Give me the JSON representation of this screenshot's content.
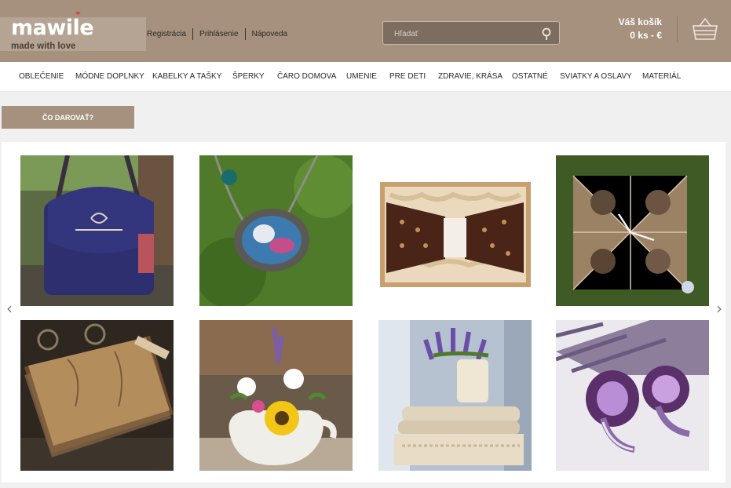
{
  "brand": {
    "name": "mawile",
    "tagline": "made with love"
  },
  "top_links": [
    {
      "label": "Registrácia"
    },
    {
      "label": "Prihlásenie"
    },
    {
      "label": "Nápoveda"
    }
  ],
  "search": {
    "placeholder": "Hľadať",
    "icon": "search-icon"
  },
  "cart": {
    "title": "Váš košík",
    "count": "0 ks - €",
    "icon": "basket-icon"
  },
  "nav": [
    {
      "label": "OBLEČENIE"
    },
    {
      "label": "MÓDNE DOPLNKY"
    },
    {
      "label": "KABELKY A TAŠKY"
    },
    {
      "label": "ŠPERKY"
    },
    {
      "label": "ČARO DOMOVA"
    },
    {
      "label": "UMENIE"
    },
    {
      "label": "PRE DETI"
    },
    {
      "label": "ZDRAVIE, KRÁSA"
    },
    {
      "label": "OSTATNÉ"
    },
    {
      "label": "SVIATKY A OSLAVY"
    },
    {
      "label": "MATERIÁL"
    }
  ],
  "gift_button": "ČO DAROVAŤ?",
  "carousel": {
    "prev": "‹",
    "next": "›"
  },
  "colors": {
    "header_bg": "#a5917e",
    "accent": "#a5917e",
    "logo_heart": "#e0443e"
  }
}
